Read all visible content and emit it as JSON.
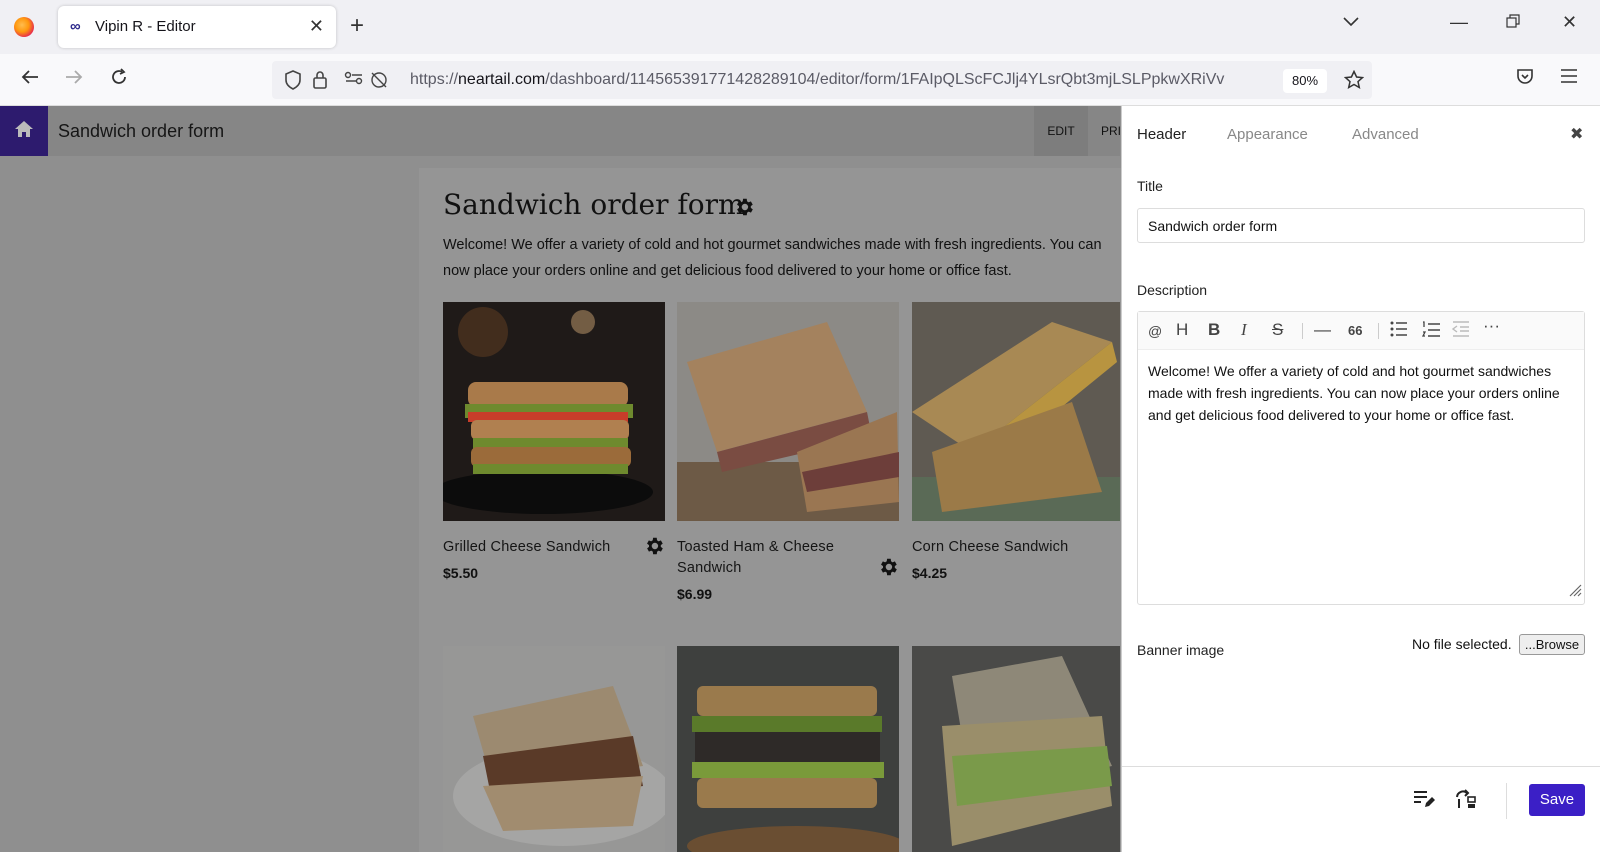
{
  "browser": {
    "tab_title": "Vipin R - Editor",
    "tab_icon": "∞",
    "new_tab": "+",
    "url_prefix": "https://",
    "url_host": "neartail.com",
    "url_path": "/dashboard/114565391771428289104/editor/form/1FAIpQLScFCJlj4YLsrQbt3mjLSLPpkwXRiVv",
    "zoom": "80%"
  },
  "app": {
    "title": "Sandwich order form",
    "mode_tabs": [
      "EDIT",
      "PRI"
    ]
  },
  "form": {
    "title": "Sandwich order form",
    "description": "Welcome! We offer a variety of cold and hot gourmet sandwiches made with fresh ingredients. You can now place your orders online and get delicious food delivered to your home or office fast.",
    "products": [
      {
        "name": "Grilled Cheese Sandwich",
        "price": "$5.50"
      },
      {
        "name": "Toasted Ham & Cheese Sandwich",
        "price": "$6.99"
      },
      {
        "name": "Corn Cheese Sandwich",
        "price": "$4.25"
      }
    ]
  },
  "panel": {
    "tabs": [
      "Header",
      "Appearance",
      "Advanced"
    ],
    "title_label": "Title",
    "title_value": "Sandwich order form",
    "description_label": "Description",
    "description_value": "Welcome! We offer a variety of cold and hot gourmet sandwiches made with fresh ingredients. You can now place your orders online and get delicious food delivered to your home or office fast.",
    "toolbar": [
      "@",
      "H",
      "B",
      "I",
      "S",
      "—",
      "66"
    ],
    "banner_label": "Banner image",
    "file_status": "No file selected.",
    "browse_label": "...Browse",
    "save_label": "Save"
  },
  "colors": {
    "accent": "#3b1fc6",
    "home": "#2d1b6e"
  }
}
